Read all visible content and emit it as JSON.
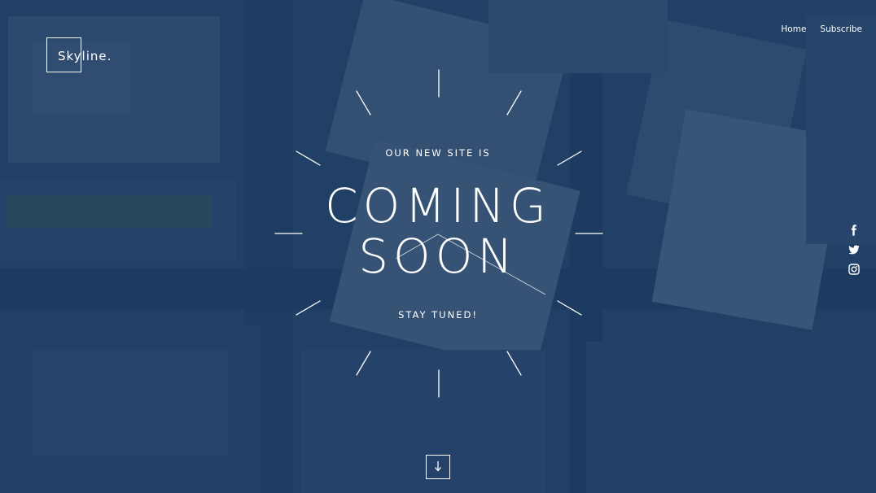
{
  "logo": {
    "text": "Skyline."
  },
  "nav": {
    "items": [
      "Home",
      "Subscribe"
    ]
  },
  "hero": {
    "kicker": "OUR NEW SITE IS",
    "headline_line1": "COMING",
    "headline_line2": "SOON",
    "tagline": "STAY TUNED!"
  },
  "social": {
    "icons": [
      "facebook-icon",
      "twitter-icon",
      "instagram-icon"
    ]
  },
  "scroll": {
    "icon": "arrow-down-icon"
  },
  "colors": {
    "overlay": "#123058",
    "text": "#ffffff"
  }
}
